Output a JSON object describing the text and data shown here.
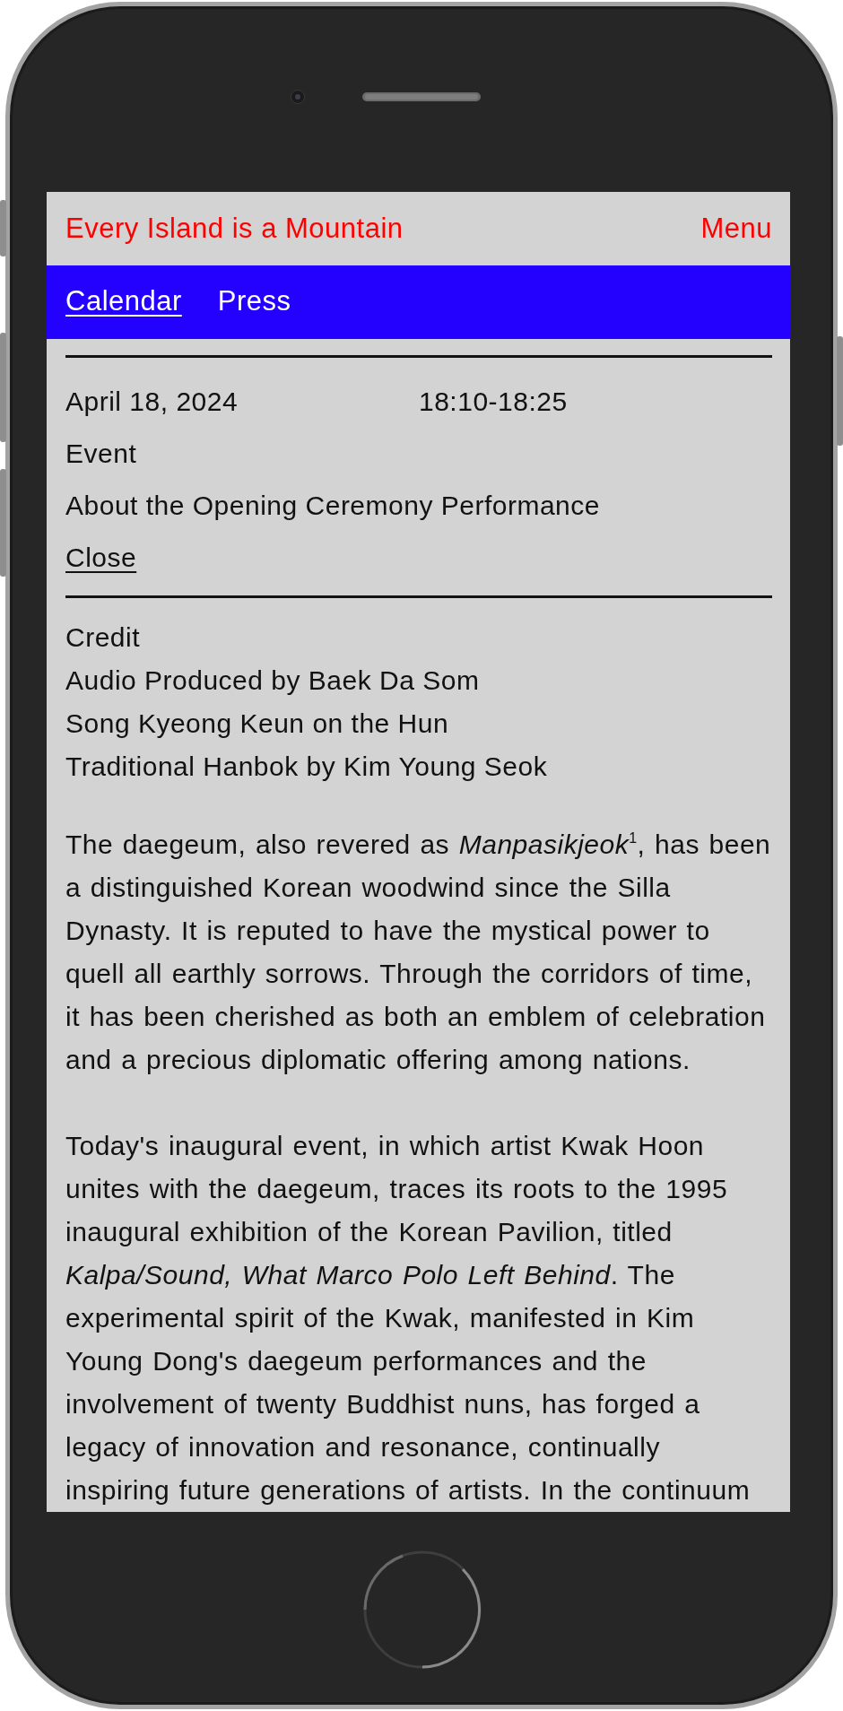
{
  "header": {
    "title": "Every Island is a Mountain",
    "menu": "Menu"
  },
  "nav": {
    "tabs": [
      {
        "label": "Calendar",
        "selected": true
      },
      {
        "label": "Press",
        "selected": false
      }
    ]
  },
  "event": {
    "date": "April 18, 2024",
    "time": "18:10-18:25",
    "category": "Event",
    "title": "About the Opening Ceremony Performance",
    "close": "Close"
  },
  "credits": {
    "heading": "Credit",
    "lines": [
      "Audio Produced by Baek Da Som",
      "Song Kyeong Keun on the Hun",
      "Traditional Hanbok by Kim Young Seok"
    ]
  },
  "body": {
    "paragraphs": [
      "The daegeum, also revered as *Manpasikjeok*$^{1}$, has been a distinguished Korean woodwind since the Silla Dynasty. It is reputed to have the mystical power to quell all earthly sorrows. Through the corridors of time, it has been cherished as both an emblem of celebration and a precious diplomatic offering among nations.",
      "Today's inaugural event, in which artist Kwak Hoon unites with the daegeum, traces its roots to the 1995 inaugural exhibition of the Korean Pavilion, titled *Kalpa/Sound, What Marco Polo Left Behind*. The experimental spirit of the Kwak, manifested in Kim Young Dong's daegeum performances and the involvement of twenty Buddhist nuns, has forged a legacy of innovation and resonance, continually inspiring future generations of artists. In the continuum"
    ]
  }
}
